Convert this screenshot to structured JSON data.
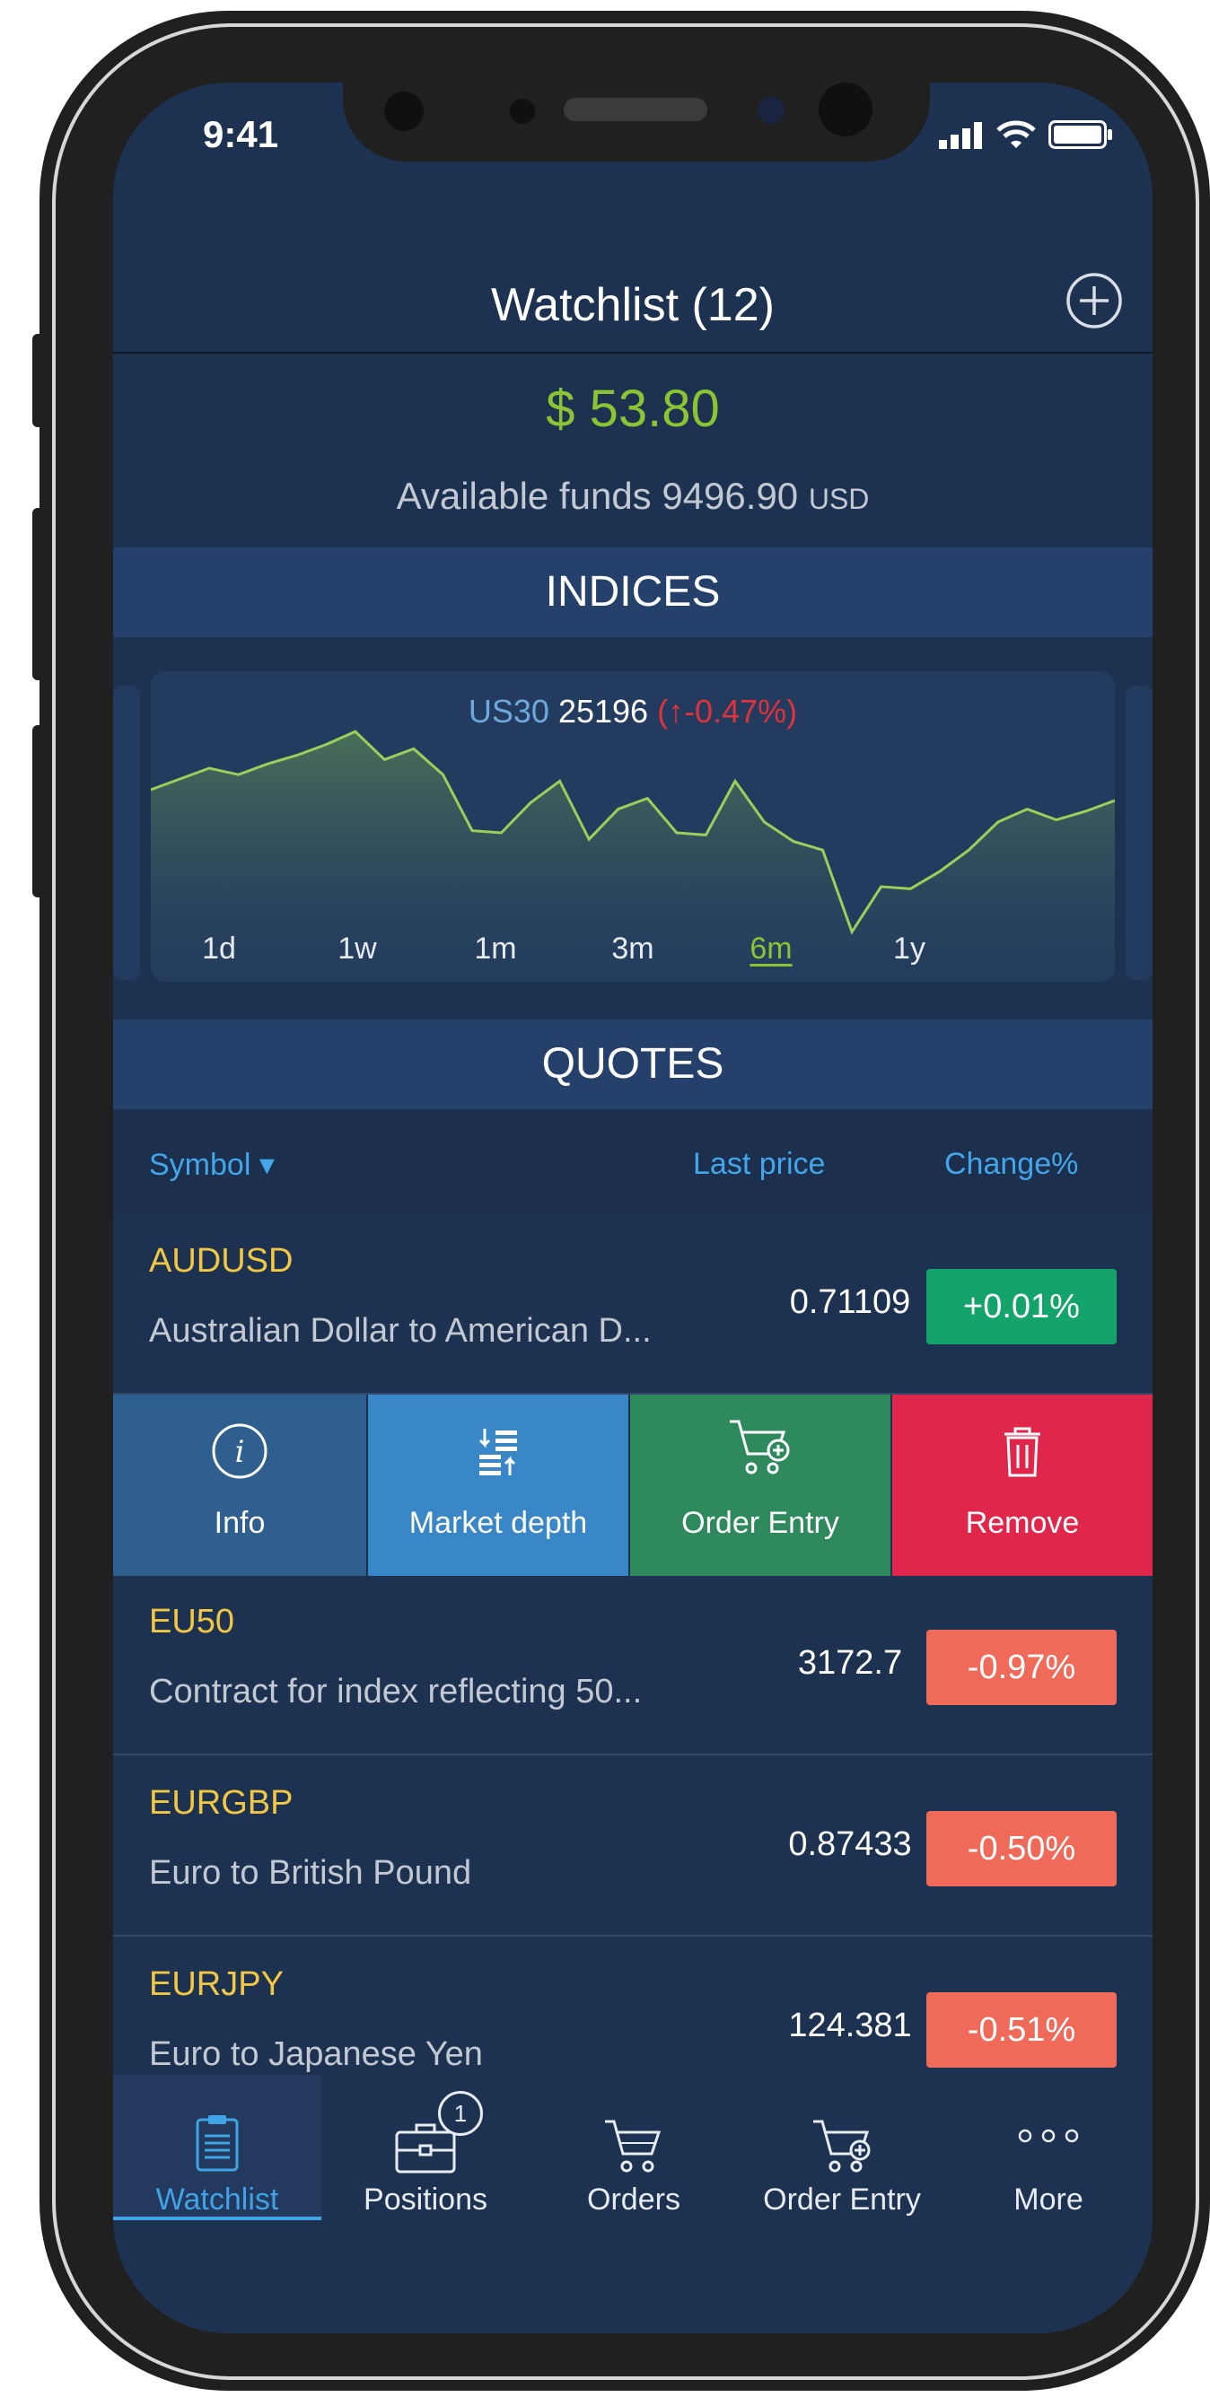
{
  "status": {
    "time": "9:41"
  },
  "header": {
    "title": "Watchlist (12)",
    "add_icon": "plus-circle-icon"
  },
  "account": {
    "balance": "$ 53.80",
    "funds_label": "Available funds 9496.90",
    "funds_unit": "USD"
  },
  "indices": {
    "section_title": "INDICES",
    "symbol": "US30",
    "price": "25196",
    "change": "(↑-0.47%)",
    "periods": [
      "1d",
      "1w",
      "1m",
      "3m",
      "6m",
      "1y"
    ],
    "active_period": "6m"
  },
  "quotes": {
    "section_title": "QUOTES",
    "col_symbol": "Symbol ▾",
    "col_last_price": "Last price",
    "col_change": "Change%",
    "rows": [
      {
        "symbol": "AUDUSD",
        "name": "Australian Dollar to American D...",
        "price": "0.71109",
        "change": "+0.01%",
        "direction": "up"
      },
      {
        "symbol": "EU50",
        "name": "Contract for index reflecting 50...",
        "price": "3172.7",
        "change": "-0.97%",
        "direction": "down"
      },
      {
        "symbol": "EURGBP",
        "name": "Euro to British Pound",
        "price": "0.87433",
        "change": "-0.50%",
        "direction": "down"
      },
      {
        "symbol": "EURJPY",
        "name": "Euro to Japanese Yen",
        "price": "124.381",
        "change": "-0.51%",
        "direction": "down"
      }
    ]
  },
  "row_actions": [
    {
      "label": "Info",
      "icon": "info-icon",
      "color": "#2f5f8e"
    },
    {
      "label": "Market depth",
      "icon": "market-depth-icon",
      "color": "#3a87c7"
    },
    {
      "label": "Order Entry",
      "icon": "cart-plus-icon",
      "color": "#2e8a5c"
    },
    {
      "label": "Remove",
      "icon": "trash-icon",
      "color": "#e0264a"
    }
  ],
  "tabbar": {
    "tabs": [
      {
        "label": "Watchlist",
        "icon": "clipboard-icon"
      },
      {
        "label": "Positions",
        "icon": "briefcase-icon",
        "badge": "1"
      },
      {
        "label": "Orders",
        "icon": "cart-icon"
      },
      {
        "label": "Order Entry",
        "icon": "cart-plus-icon"
      },
      {
        "label": "More",
        "icon": "more-dots-icon"
      }
    ],
    "active": "Watchlist"
  },
  "colors": {
    "background": "#1d3150",
    "accent_green": "#8ac433",
    "positive": "#14a36a",
    "negative": "#ef6a59",
    "symbol": "#f2c744",
    "link_blue": "#43a6ea"
  },
  "sparkline": [
    50,
    55,
    60,
    57,
    62,
    66,
    71,
    77,
    64,
    69,
    57,
    31,
    30,
    44,
    54,
    27,
    41,
    46,
    30,
    29,
    54,
    35,
    26,
    22,
    -16,
    5,
    4,
    12,
    22,
    35,
    41,
    36,
    40,
    45
  ]
}
